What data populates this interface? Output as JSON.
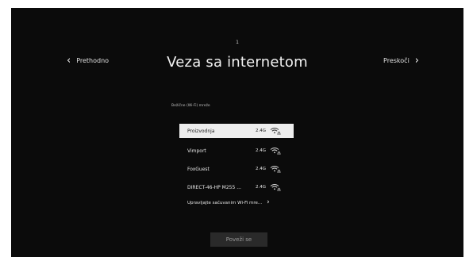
{
  "header": {
    "step_indicator": "1",
    "title": "Veza sa internetom",
    "back_label": "Prethodno",
    "skip_label": "Preskoči"
  },
  "network_list": {
    "header": "Bežične (Wi-Fi) mreže",
    "networks": [
      {
        "name": "Proizvodnja",
        "band": "2.4G",
        "icon": "wifi-lock-icon",
        "selected": true
      },
      {
        "name": "Vimport",
        "band": "2.4G",
        "icon": "wifi-lock-icon",
        "selected": false
      },
      {
        "name": "FoxGuest",
        "band": "2.4G",
        "icon": "wifi-lock-icon",
        "selected": false
      },
      {
        "name": "DIRECT-46-HP M255 ...",
        "band": "2.4G",
        "icon": "wifi-lock-icon",
        "selected": false
      }
    ],
    "manage_label": "Upravljajte sačuvanim Wi-Fi mre..."
  },
  "footer": {
    "connect_label": "Poveži se"
  },
  "colors": {
    "background": "#0b0b0b",
    "selected_row": "#eeeeee",
    "text": "#e8e8e8",
    "button_disabled": "#2a2a2a"
  }
}
